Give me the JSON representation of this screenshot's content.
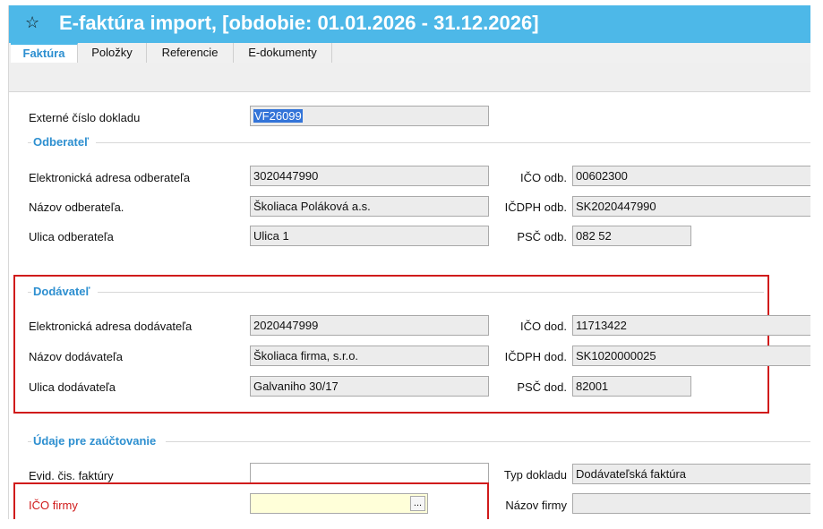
{
  "window": {
    "title": "E-faktúra import, [obdobie: 01.01.2026 - 31.12.2026]",
    "star": "☆"
  },
  "tabs": [
    "Faktúra",
    "Položky",
    "Referencie",
    "E-dokumenty"
  ],
  "fields": {
    "ext_doc_label": "Externé číslo dokladu",
    "ext_doc_value": "VF26099"
  },
  "odberatel": {
    "section": "Odberateľ",
    "addr_label": "Elektronická adresa odberateľa",
    "addr_value": "3020447990",
    "name_label": "Názov odberateľa.",
    "name_value": "Školiaca Poláková a.s.",
    "street_label": "Ulica odberateľa",
    "street_value": "Ulica 1",
    "ico_label": "IČO odb.",
    "ico_value": "00602300",
    "icdph_label": "IČDPH odb.",
    "icdph_value": "SK2020447990",
    "psc_label": "PSČ odb.",
    "psc_value": "082 52"
  },
  "dodavatel": {
    "section": "Dodávateľ",
    "addr_label": "Elektronická adresa dodávateľa",
    "addr_value": "2020447999",
    "name_label": "Názov dodávateľa",
    "name_value": "Školiaca firma, s.r.o.",
    "street_label": "Ulica dodávateľa",
    "street_value": "Galvaniho 30/17",
    "ico_label": "IČO dod.",
    "ico_value": "11713422",
    "icdph_label": "IČDPH dod.",
    "icdph_value": "SK1020000025",
    "psc_label": "PSČ dod.",
    "psc_value": "82001"
  },
  "uctovanie": {
    "section": "Údaje pre zaúčtovanie",
    "evid_label": "Evid. čis. faktúry",
    "evid_value": "",
    "typ_label": "Typ dokladu",
    "typ_value": "Dodávateľská faktúra",
    "ico_firmy_label": "IČO firmy",
    "ico_firmy_value": "",
    "browse": "...",
    "nazov_firmy_label": "Názov firmy",
    "nazov_firmy_value": ""
  },
  "colors": {
    "titlebar": "#4db8e8",
    "accent": "#2d8fd0",
    "highlight_box": "#d01b1b",
    "required_label": "#d01b1b"
  }
}
